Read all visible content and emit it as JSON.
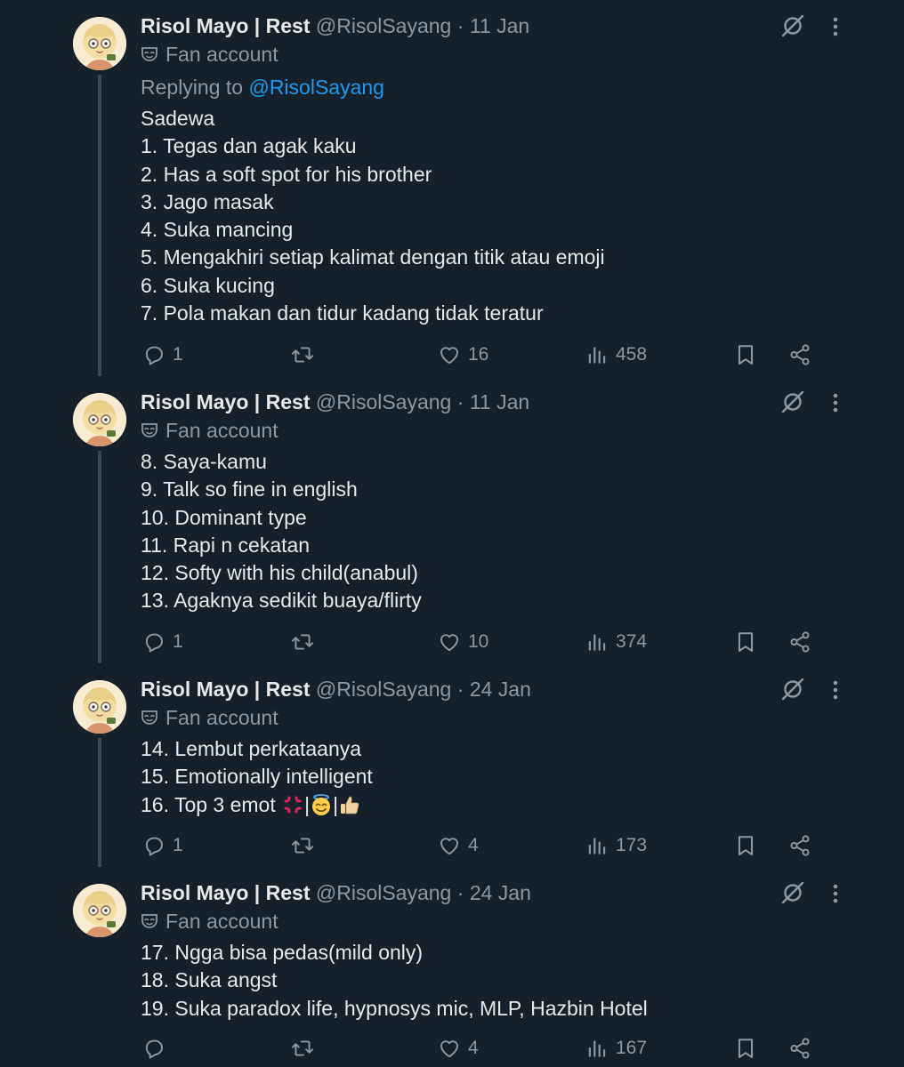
{
  "account": {
    "name": "Risol Mayo | Rest",
    "handle": "@RisolSayang",
    "label": "Fan account"
  },
  "colors": {
    "background": "#15202b",
    "secondary_text": "#8b98a5",
    "primary_text": "#e7e9ea",
    "link": "#1d9bf0",
    "thread_line": "#3b4753"
  },
  "icons": {
    "reply": "reply-icon",
    "retweet": "retweet-icon",
    "like": "heart-icon",
    "views": "views-icon",
    "bookmark": "bookmark-icon",
    "share": "share-icon",
    "grok": "grok-icon",
    "more": "more-icon",
    "label": "mask-icon"
  },
  "tweets": [
    {
      "date": "11 Jan",
      "replying_prefix": "Replying to",
      "replying_to": "@RisolSayang",
      "lines": [
        "Sadewa",
        "1. Tegas dan agak kaku",
        "2. Has a soft spot for his brother",
        "3. Jago masak",
        "4. Suka mancing",
        "5. Mengakhiri setiap kalimat dengan titik atau emoji",
        "6. Suka kucing",
        "7. Pola makan dan tidur kadang tidak teratur"
      ],
      "stats": {
        "replies": "1",
        "retweets": "",
        "likes": "16",
        "views": "458"
      }
    },
    {
      "date": "11 Jan",
      "lines": [
        "8. Saya-kamu",
        "9. Talk so fine in english",
        "10. Dominant type",
        "11. Rapi n cekatan",
        "12. Softy with his child(anabul)",
        "13. Agaknya sedikit buaya/flirty"
      ],
      "stats": {
        "replies": "1",
        "retweets": "",
        "likes": "10",
        "views": "374"
      }
    },
    {
      "date": "24 Jan",
      "lines": [
        "14. Lembut perkataanya",
        "15. Emotionally intelligent",
        "16. Top 3 emot"
      ],
      "emoji_line": {
        "separator": "|",
        "emojis": [
          "anger-emoji",
          "halo-face-emoji",
          "thumbs-up-emoji"
        ]
      },
      "stats": {
        "replies": "1",
        "retweets": "",
        "likes": "4",
        "views": "173"
      }
    },
    {
      "date": "24 Jan",
      "lines": [
        "17. Ngga bisa pedas(mild only)",
        "18. Suka angst",
        "19. Suka paradox life, hypnosys mic, MLP, Hazbin Hotel"
      ],
      "stats": {
        "replies": "",
        "retweets": "",
        "likes": "4",
        "views": "167"
      }
    }
  ]
}
